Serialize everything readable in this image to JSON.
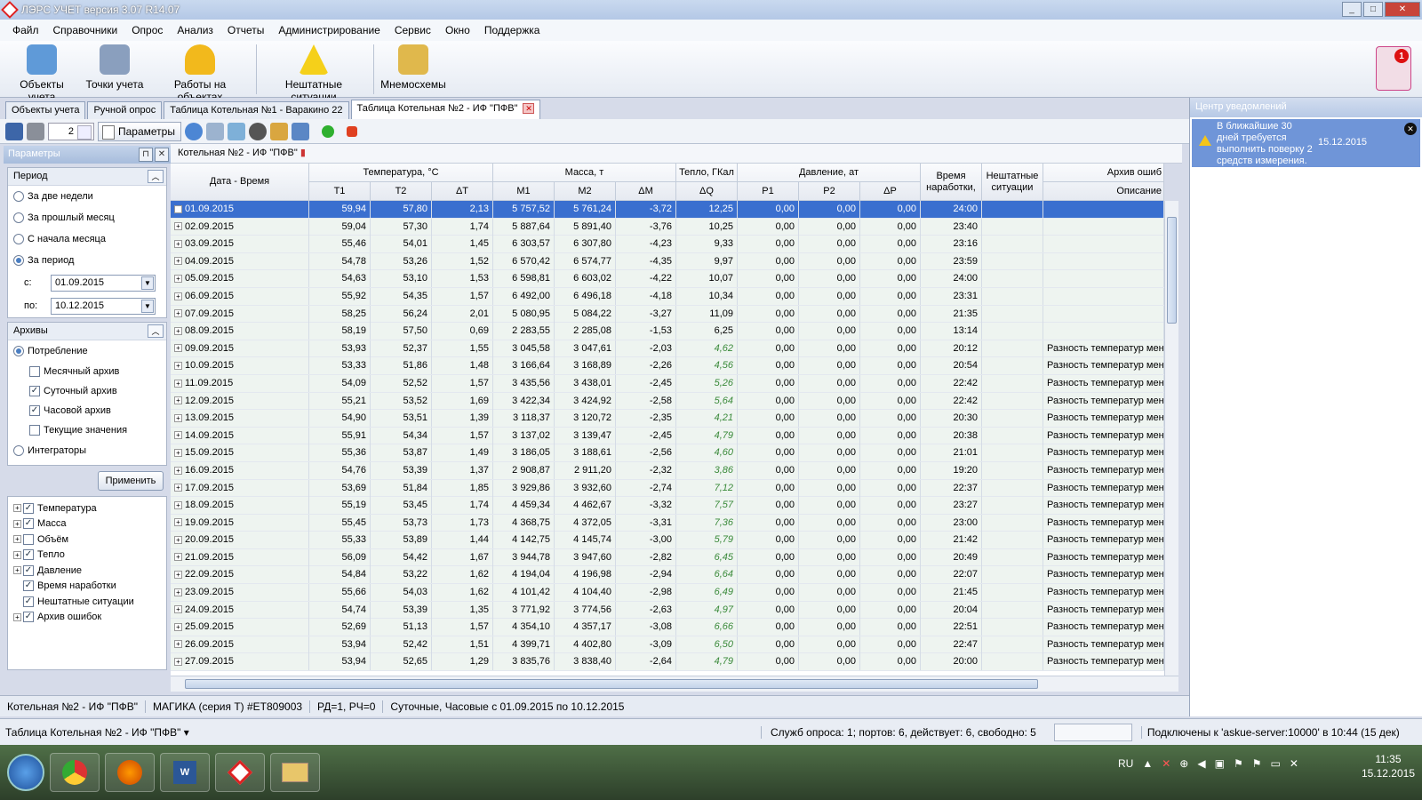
{
  "window": {
    "title": "ЛЭРС УЧЕТ версия 3.07 R14.07"
  },
  "menu": [
    "Файл",
    "Справочники",
    "Опрос",
    "Анализ",
    "Отчеты",
    "Администрирование",
    "Сервис",
    "Окно",
    "Поддержка"
  ],
  "ribbon": {
    "objects": "Объекты учета",
    "points": "Точки учета",
    "works": "Работы на объектах",
    "emergency": "Нештатные ситуации",
    "mnemo": "Мнемосхемы",
    "notification_count": "1"
  },
  "tabs": [
    "Объекты учета",
    "Ручной опрос",
    "Таблица Котельная №1 - Варакино 22",
    "Таблица Котельная №2 - ИФ \"ПФВ\""
  ],
  "toolbar": {
    "spin_value": "2",
    "params_label": "Параметры"
  },
  "left": {
    "header": "Параметры",
    "period_title": "Период",
    "period_options": [
      "За две недели",
      "За прошлый месяц",
      "С начала месяца",
      "За период"
    ],
    "from_label": "с:",
    "from_value": "01.09.2015",
    "to_label": "по:",
    "to_value": "10.12.2015",
    "archives_title": "Архивы",
    "consumption": "Потребление",
    "archive_checks": [
      "Месячный архив",
      "Суточный архив",
      "Часовой архив",
      "Текущие значения"
    ],
    "integrators": "Интеграторы",
    "apply": "Применить",
    "tree": [
      "Температура",
      "Масса",
      "Объём",
      "Тепло",
      "Давление",
      "Время наработки",
      "Нештатные ситуации",
      "Архив ошибок"
    ]
  },
  "object_title": "Котельная №2 - ИФ \"ПФВ\"",
  "grid": {
    "group_headers": {
      "temp": "Температура, °С",
      "mass": "Масса, т",
      "heat": "Тепло, ГКал",
      "pressure": "Давление, ат",
      "runtime": "Время наработки,",
      "emerg": "Нештатные ситуации",
      "errors": "Архив ошиб"
    },
    "col_headers": {
      "date": "Дата - Время",
      "t1": "T1",
      "t2": "T2",
      "dt": "ΔT",
      "m1": "M1",
      "m2": "M2",
      "dm": "ΔM",
      "dq": "ΔQ",
      "p1": "P1",
      "p2": "P2",
      "dp": "ΔP",
      "desc": "Описание"
    },
    "rows": [
      [
        "01.09.2015",
        "59,94",
        "57,80",
        "2,13",
        "5 757,52",
        "5 761,24",
        "-3,72",
        "12,25",
        "0,00",
        "0,00",
        "0,00",
        "24:00",
        ""
      ],
      [
        "02.09.2015",
        "59,04",
        "57,30",
        "1,74",
        "5 887,64",
        "5 891,40",
        "-3,76",
        "10,25",
        "0,00",
        "0,00",
        "0,00",
        "23:40",
        ""
      ],
      [
        "03.09.2015",
        "55,46",
        "54,01",
        "1,45",
        "6 303,57",
        "6 307,80",
        "-4,23",
        "9,33",
        "0,00",
        "0,00",
        "0,00",
        "23:16",
        ""
      ],
      [
        "04.09.2015",
        "54,78",
        "53,26",
        "1,52",
        "6 570,42",
        "6 574,77",
        "-4,35",
        "9,97",
        "0,00",
        "0,00",
        "0,00",
        "23:59",
        ""
      ],
      [
        "05.09.2015",
        "54,63",
        "53,10",
        "1,53",
        "6 598,81",
        "6 603,02",
        "-4,22",
        "10,07",
        "0,00",
        "0,00",
        "0,00",
        "24:00",
        ""
      ],
      [
        "06.09.2015",
        "55,92",
        "54,35",
        "1,57",
        "6 492,00",
        "6 496,18",
        "-4,18",
        "10,34",
        "0,00",
        "0,00",
        "0,00",
        "23:31",
        ""
      ],
      [
        "07.09.2015",
        "58,25",
        "56,24",
        "2,01",
        "5 080,95",
        "5 084,22",
        "-3,27",
        "11,09",
        "0,00",
        "0,00",
        "0,00",
        "21:35",
        ""
      ],
      [
        "08.09.2015",
        "58,19",
        "57,50",
        "0,69",
        "2 283,55",
        "2 285,08",
        "-1,53",
        "6,25",
        "0,00",
        "0,00",
        "0,00",
        "13:14",
        ""
      ],
      [
        "09.09.2015",
        "53,93",
        "52,37",
        "1,55",
        "3 045,58",
        "3 047,61",
        "-2,03",
        "4,62",
        "0,00",
        "0,00",
        "0,00",
        "20:12",
        "Разность температур мень"
      ],
      [
        "10.09.2015",
        "53,33",
        "51,86",
        "1,48",
        "3 166,64",
        "3 168,89",
        "-2,26",
        "4,56",
        "0,00",
        "0,00",
        "0,00",
        "20:54",
        "Разность температур мень"
      ],
      [
        "11.09.2015",
        "54,09",
        "52,52",
        "1,57",
        "3 435,56",
        "3 438,01",
        "-2,45",
        "5,26",
        "0,00",
        "0,00",
        "0,00",
        "22:42",
        "Разность температур мень"
      ],
      [
        "12.09.2015",
        "55,21",
        "53,52",
        "1,69",
        "3 422,34",
        "3 424,92",
        "-2,58",
        "5,64",
        "0,00",
        "0,00",
        "0,00",
        "22:42",
        "Разность температур мень"
      ],
      [
        "13.09.2015",
        "54,90",
        "53,51",
        "1,39",
        "3 118,37",
        "3 120,72",
        "-2,35",
        "4,21",
        "0,00",
        "0,00",
        "0,00",
        "20:30",
        "Разность температур мень"
      ],
      [
        "14.09.2015",
        "55,91",
        "54,34",
        "1,57",
        "3 137,02",
        "3 139,47",
        "-2,45",
        "4,79",
        "0,00",
        "0,00",
        "0,00",
        "20:38",
        "Разность температур мень"
      ],
      [
        "15.09.2015",
        "55,36",
        "53,87",
        "1,49",
        "3 186,05",
        "3 188,61",
        "-2,56",
        "4,60",
        "0,00",
        "0,00",
        "0,00",
        "21:01",
        "Разность температур мень"
      ],
      [
        "16.09.2015",
        "54,76",
        "53,39",
        "1,37",
        "2 908,87",
        "2 911,20",
        "-2,32",
        "3,86",
        "0,00",
        "0,00",
        "0,00",
        "19:20",
        "Разность температур мень"
      ],
      [
        "17.09.2015",
        "53,69",
        "51,84",
        "1,85",
        "3 929,86",
        "3 932,60",
        "-2,74",
        "7,12",
        "0,00",
        "0,00",
        "0,00",
        "22:37",
        "Разность температур мень"
      ],
      [
        "18.09.2015",
        "55,19",
        "53,45",
        "1,74",
        "4 459,34",
        "4 462,67",
        "-3,32",
        "7,57",
        "0,00",
        "0,00",
        "0,00",
        "23:27",
        "Разность температур мень"
      ],
      [
        "19.09.2015",
        "55,45",
        "53,73",
        "1,73",
        "4 368,75",
        "4 372,05",
        "-3,31",
        "7,36",
        "0,00",
        "0,00",
        "0,00",
        "23:00",
        "Разность температур мень"
      ],
      [
        "20.09.2015",
        "55,33",
        "53,89",
        "1,44",
        "4 142,75",
        "4 145,74",
        "-3,00",
        "5,79",
        "0,00",
        "0,00",
        "0,00",
        "21:42",
        "Разность температур мень"
      ],
      [
        "21.09.2015",
        "56,09",
        "54,42",
        "1,67",
        "3 944,78",
        "3 947,60",
        "-2,82",
        "6,45",
        "0,00",
        "0,00",
        "0,00",
        "20:49",
        "Разность температур мень"
      ],
      [
        "22.09.2015",
        "54,84",
        "53,22",
        "1,62",
        "4 194,04",
        "4 196,98",
        "-2,94",
        "6,64",
        "0,00",
        "0,00",
        "0,00",
        "22:07",
        "Разность температур мень"
      ],
      [
        "23.09.2015",
        "55,66",
        "54,03",
        "1,62",
        "4 101,42",
        "4 104,40",
        "-2,98",
        "6,49",
        "0,00",
        "0,00",
        "0,00",
        "21:45",
        "Разность температур мень"
      ],
      [
        "24.09.2015",
        "54,74",
        "53,39",
        "1,35",
        "3 771,92",
        "3 774,56",
        "-2,63",
        "4,97",
        "0,00",
        "0,00",
        "0,00",
        "20:04",
        "Разность температур мень"
      ],
      [
        "25.09.2015",
        "52,69",
        "51,13",
        "1,57",
        "4 354,10",
        "4 357,17",
        "-3,08",
        "6,66",
        "0,00",
        "0,00",
        "0,00",
        "22:51",
        "Разность температур мень"
      ],
      [
        "26.09.2015",
        "53,94",
        "52,42",
        "1,51",
        "4 399,71",
        "4 402,80",
        "-3,09",
        "6,50",
        "0,00",
        "0,00",
        "0,00",
        "22:47",
        "Разность температур мень"
      ],
      [
        "27.09.2015",
        "53,94",
        "52,65",
        "1,29",
        "3 835,76",
        "3 838,40",
        "-2,64",
        "4,79",
        "0,00",
        "0,00",
        "0,00",
        "20:00",
        "Разность температур мень"
      ]
    ]
  },
  "status": {
    "object": "Котельная №2 - ИФ \"ПФВ\"",
    "device": "МАГИКА (серия Т) #ET809003",
    "rd": "РД=1, РЧ=0",
    "archives": "Суточные, Часовые с 01.09.2015 по 10.12.2015"
  },
  "notifications": {
    "header": "Центр уведомлений",
    "text": "В ближайшие 30 дней требуется выполнить поверку 2 средств измерения.",
    "date": "15.12.2015"
  },
  "bottom": {
    "current": "Таблица Котельная №2 - ИФ \"ПФВ\"",
    "services": "Служб опроса: 1; портов: 6, действует: 6, свободно: 5",
    "connected": "Подключены к 'askue-server:10000' в 10:44 (15 дек)"
  },
  "taskbar": {
    "lang": "RU",
    "time": "11:35",
    "date": "15.12.2015"
  },
  "colors": {
    "selection": "#3a6fcf",
    "green_value": "#3a8a3a",
    "notif_bg": "#6f95d8"
  }
}
